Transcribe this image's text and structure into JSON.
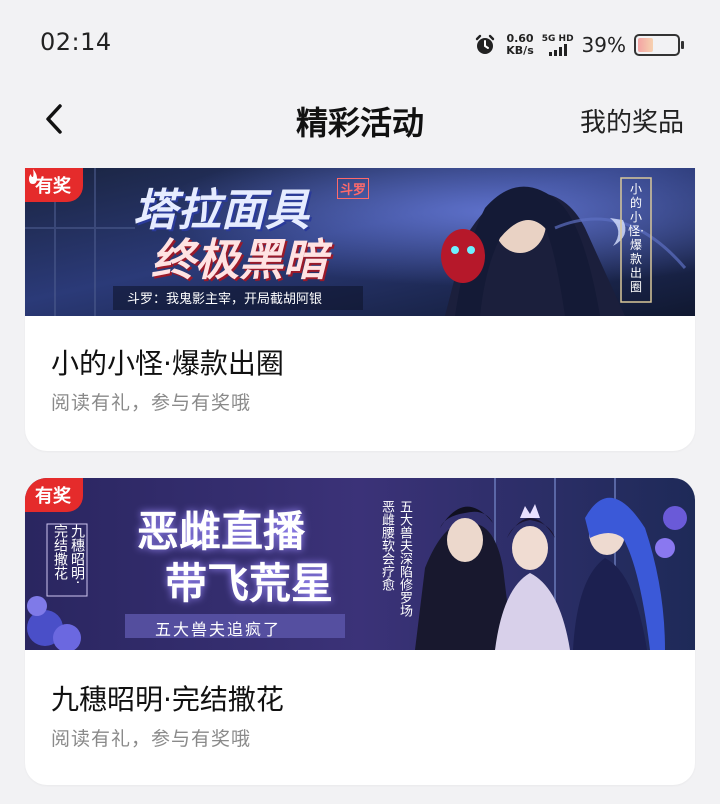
{
  "status_bar": {
    "time": "02:14",
    "speed_value": "0.60",
    "speed_unit": "KB/s",
    "signal_label": "5G HD",
    "battery_percent": "39%",
    "battery_level": 0.39
  },
  "header": {
    "title": "精彩活动",
    "right_link": "我的奖品"
  },
  "activities": [
    {
      "badge": "有奖",
      "badge_icon": "flame-icon",
      "banner": {
        "headline_1": "塔拉面具",
        "headline_tag": "斗罗",
        "headline_2": "终极黑暗",
        "caption": "斗罗：我鬼影主宰，开局截胡阿银",
        "vertical_tag": "小的小怪·爆款出圈"
      },
      "title": "小的小怪·爆款出圈",
      "subtitle": "阅读有礼，参与有奖哦"
    },
    {
      "badge": "有奖",
      "banner": {
        "headline_1": "恶雌直播",
        "headline_2": "带飞荒星",
        "caption": "五大兽夫追疯了",
        "vertical_author": "九穗昭明·完结撒花",
        "vertical_blurb": "五大兽夫深陷修罗场 恶雌腰软会疗愈"
      },
      "title": "九穗昭明·完结撒花",
      "subtitle": "阅读有礼，参与有奖哦"
    }
  ],
  "colors": {
    "badge_red": "#e52b2b",
    "background": "#f2f2f4"
  }
}
